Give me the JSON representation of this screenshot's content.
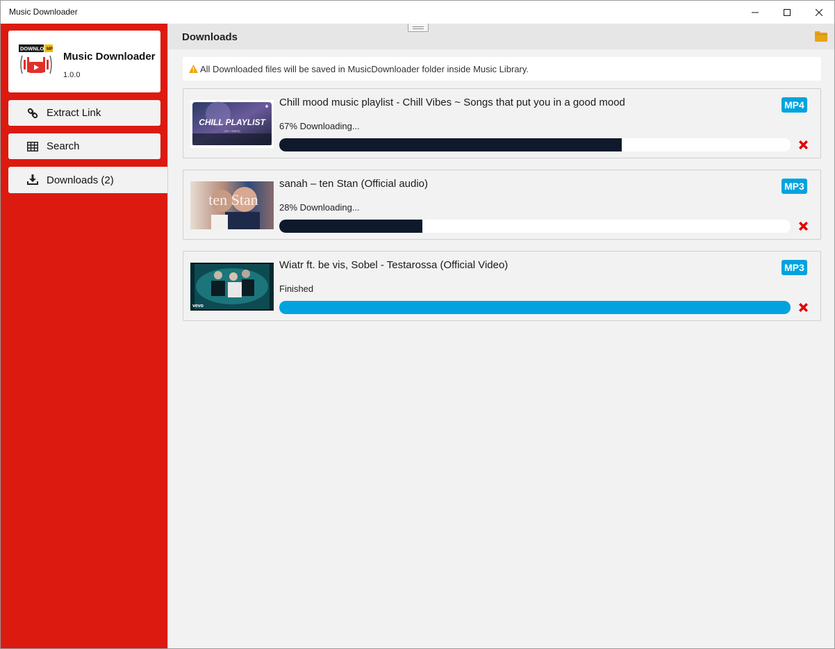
{
  "window": {
    "title": "Music Downloader"
  },
  "sidebar": {
    "app_name": "Music Downloader",
    "version": "1.0.0",
    "logo_text": "DOWNLOAD",
    "items": [
      {
        "label": "Extract Link",
        "icon": "link-icon"
      },
      {
        "label": "Search",
        "icon": "table-icon"
      },
      {
        "label": "Downloads (2)",
        "icon": "download-icon"
      }
    ]
  },
  "main": {
    "title": "Downloads",
    "notice": "All Downloaded files will be saved in MusicDownloader folder inside Music Library.",
    "downloads": [
      {
        "title": "Chill mood music playlist - Chill Vibes ~ Songs that put you in a good mood",
        "status": "67% Downloading...",
        "format": "MP4",
        "progress": 0.67,
        "thumb_text": "CHILL PLAYLIST",
        "thumb_subtext": "(SKY VIBES)"
      },
      {
        "title": "sanah – ten Stan (Official audio)",
        "status": "28% Downloading...",
        "format": "MP3",
        "progress": 0.28,
        "thumb_text": "ten Stan"
      },
      {
        "title": "Wiatr ft. be vis, Sobel - Testarossa (Official Video)",
        "status": "Finished",
        "format": "MP3",
        "progress": 1.0,
        "thumb_text": "vevo"
      }
    ]
  },
  "colors": {
    "sidebar": "#dd1a0f",
    "accent": "#00a3e0",
    "progress_active": "#0e1a2b",
    "remove": "#e00000",
    "folder": "#e8a317"
  }
}
